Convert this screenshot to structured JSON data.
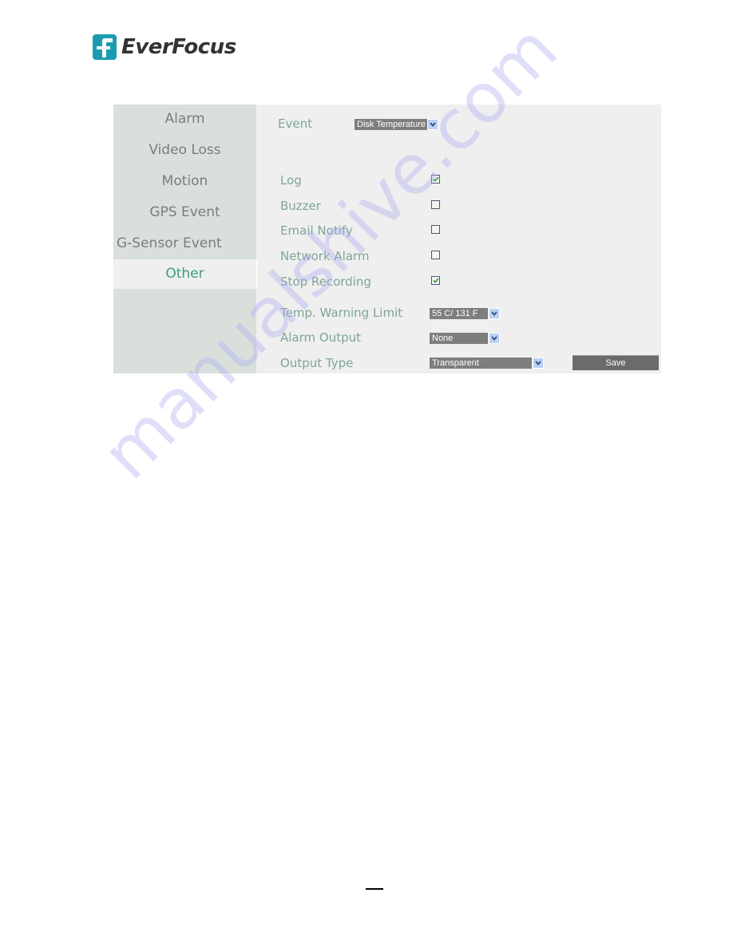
{
  "brand": {
    "name": "EverFocus",
    "logo_icon": "everfocus-f-logo-icon",
    "colors": {
      "logo_mark": "#1b9bb0",
      "logo_text": "#333335"
    }
  },
  "sidebar": {
    "items": [
      {
        "label": "Alarm",
        "active": false
      },
      {
        "label": "Video Loss",
        "active": false
      },
      {
        "label": "Motion",
        "active": false
      },
      {
        "label": "GPS Event",
        "active": false
      },
      {
        "label": "G-Sensor Event",
        "active": false
      },
      {
        "label": "Other",
        "active": true
      }
    ],
    "colors": {
      "background": "#d9e0db",
      "text": "#7c7c7c",
      "active_text": "#3f9a82"
    }
  },
  "form": {
    "event": {
      "label": "Event",
      "value": "Disk Temperature"
    },
    "checkboxes": [
      {
        "label": "Log",
        "checked": true
      },
      {
        "label": "Buzzer",
        "checked": false
      },
      {
        "label": "Email Notify",
        "checked": false
      },
      {
        "label": "Network Alarm",
        "checked": false
      },
      {
        "label": "Stop Recording",
        "checked": true
      }
    ],
    "temp_warning_limit": {
      "label": "Temp. Warning Limit",
      "value": "55 C/ 131 F"
    },
    "alarm_output": {
      "label": "Alarm Output",
      "value": "None"
    },
    "output_type": {
      "label": "Output Type",
      "value": "Transparent"
    },
    "save_label": "Save",
    "colors": {
      "label": "#7fa49a",
      "select_bg": "#7e7e7e",
      "arrow_bg": "#bcd0f4",
      "check": "#2e9a2e",
      "button_bg": "#6b6b6b"
    }
  },
  "watermark": {
    "text": "manualshive.com"
  },
  "footer": {
    "page_number": ""
  }
}
